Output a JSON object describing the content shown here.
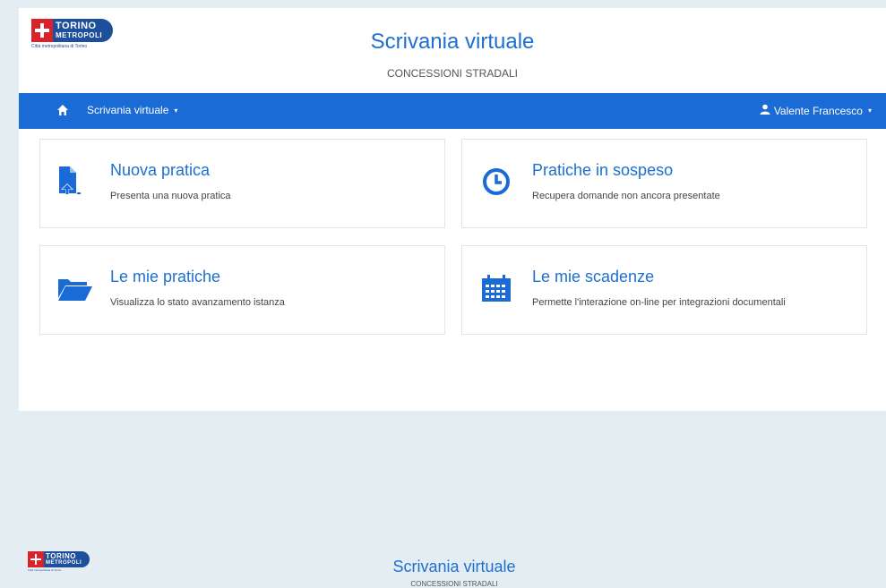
{
  "header": {
    "logo": {
      "word_top": "TORINO",
      "word_bottom": "METROPOLI",
      "caption": "Città metropolitana di Torino"
    },
    "title": "Scrivania virtuale",
    "subtitle": "CONCESSIONI STRADALI"
  },
  "navbar": {
    "home_icon": "home-icon",
    "menu_label": "Scrivania virtuale",
    "user_icon": "user-icon",
    "user_label": "Valente Francesco"
  },
  "cards": [
    {
      "title": "Nuova pratica",
      "description": "Presenta una nuova pratica",
      "icon": "file-upload-icon"
    },
    {
      "title": "Pratiche in sospeso",
      "description": "Recupera domande non ancora presentate",
      "icon": "clock-icon"
    },
    {
      "title": "Le mie pratiche",
      "description": "Visualizza lo stato avanzamento istanza",
      "icon": "folder-open-icon"
    },
    {
      "title": "Le mie scadenze",
      "description": "Permette l'interazione on-line per integrazioni documentali",
      "icon": "calendar-icon"
    }
  ],
  "duplicate_header": {
    "logo": {
      "word_top": "TORINO",
      "word_bottom": "METROPOLI",
      "caption": "Città metropolitana di Torino"
    },
    "title": "Scrivania virtuale",
    "subtitle": "CONCESSIONI STRADALI"
  },
  "colors": {
    "primary": "#1b6bd6",
    "link": "#1d6fd0",
    "logo_red": "#d8232a",
    "logo_blue": "#1d4f9c",
    "backdrop": "#e4eef2"
  }
}
